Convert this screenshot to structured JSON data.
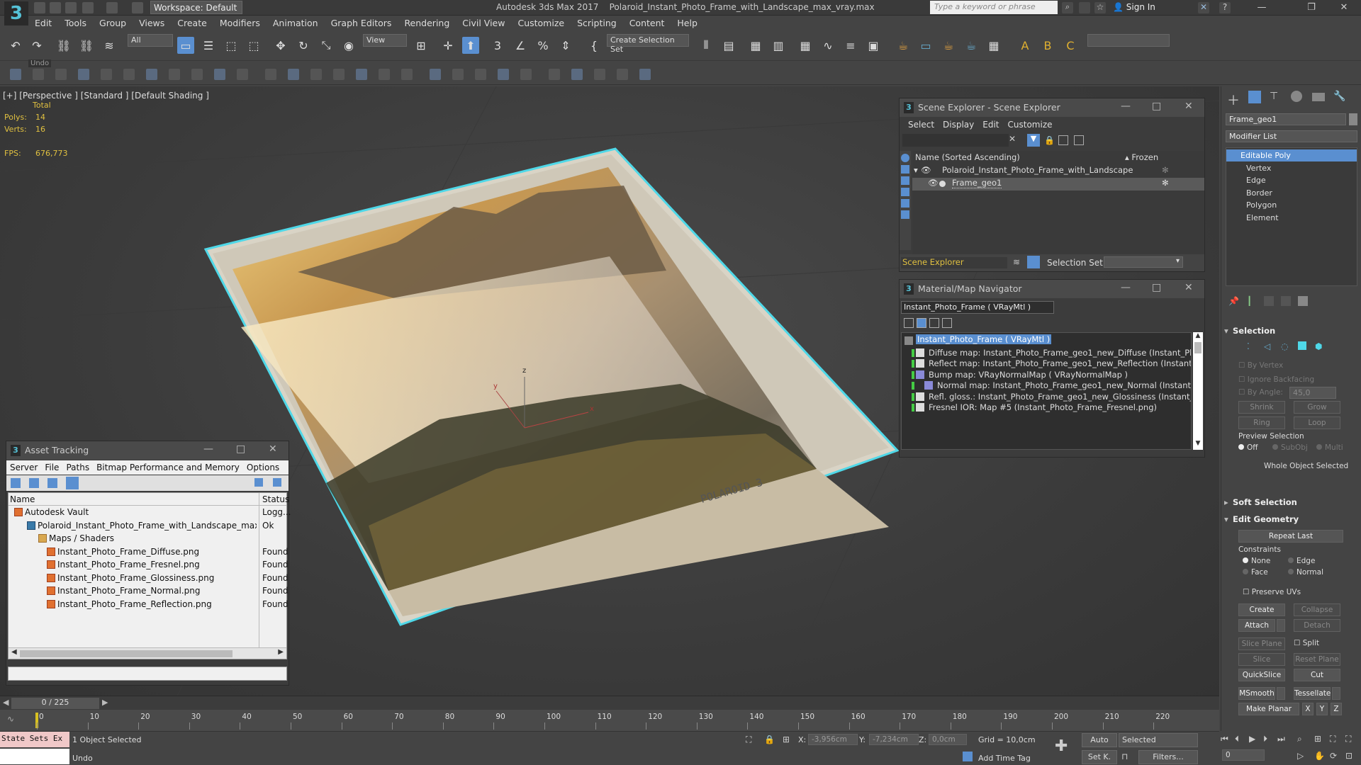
{
  "window": {
    "app_title": "Autodesk 3ds Max 2017",
    "file_title": "Polaroid_Instant_Photo_Frame_with_Landscape_max_vray.max",
    "workspace": "Workspace: Default",
    "search_placeholder": "Type a keyword or phrase",
    "sign_in": "Sign In",
    "logo": "3"
  },
  "menu": [
    "Edit",
    "Tools",
    "Group",
    "Views",
    "Create",
    "Modifiers",
    "Animation",
    "Graph Editors",
    "Rendering",
    "Civil View",
    "Customize",
    "Scripting",
    "Content",
    "Help"
  ],
  "toolbar": {
    "filter": "All",
    "refcoord": "View",
    "selection_set": "Create Selection Set",
    "undo_tooltip": "Undo"
  },
  "viewport": {
    "label": "[+] [Perspective ] [Standard ] [Default Shading ]",
    "stats_header": "Total",
    "polys_label": "Polys:",
    "polys": "14",
    "verts_label": "Verts:",
    "verts": "16",
    "fps_label": "FPS:",
    "fps": "676,773",
    "photo_text": "POLAROID 3",
    "gizmo_z": "z",
    "gizmo_x": "x",
    "gizmo_y": "y"
  },
  "scene_explorer": {
    "title": "Scene Explorer - Scene Explorer",
    "menu": [
      "Select",
      "Display",
      "Edit",
      "Customize"
    ],
    "col_name": "Name (Sorted Ascending)",
    "col_frozen": "▴ Frozen",
    "items": [
      {
        "label": "Polaroid_Instant_Photo_Frame_with_Landscape"
      },
      {
        "label": "Frame_geo1"
      }
    ],
    "footer_name": "Scene Explorer",
    "selection_set_label": "Selection Set:"
  },
  "material_navigator": {
    "title": "Material/Map Navigator",
    "current": "Instant_Photo_Frame  ( VRayMtl )",
    "root": "Instant_Photo_Frame  ( VRayMtl )",
    "maps": [
      "Diffuse map: Instant_Photo_Frame_geo1_new_Diffuse (Instant_Photo_Frame_D",
      "Reflect map: Instant_Photo_Frame_geo1_new_Reflection (Instant_Photo_Fram",
      "Bump map: VRayNormalMap  ( VRayNormalMap )",
      "Normal map: Instant_Photo_Frame_geo1_new_Normal (Instant_Photo_Frame",
      "Refl. gloss.: Instant_Photo_Frame_geo1_new_Glossiness (Instant_Photo_Frame",
      "Fresnel IOR: Map #5 (Instant_Photo_Frame_Fresnel.png)"
    ]
  },
  "asset_tracking": {
    "title": "Asset Tracking",
    "menu": [
      "Server",
      "File",
      "Paths",
      "Bitmap Performance and Memory",
      "Options"
    ],
    "col_name": "Name",
    "col_status": "Status",
    "rows": [
      {
        "name": "Autodesk Vault",
        "status": "Logg...",
        "level": 0,
        "icon": "vault"
      },
      {
        "name": "Polaroid_Instant_Photo_Frame_with_Landscape_max_vray....",
        "status": "Ok",
        "level": 1,
        "icon": "max"
      },
      {
        "name": "Maps / Shaders",
        "status": "",
        "level": 2,
        "icon": "folder"
      },
      {
        "name": "Instant_Photo_Frame_Diffuse.png",
        "status": "Found",
        "level": 3,
        "icon": "file"
      },
      {
        "name": "Instant_Photo_Frame_Fresnel.png",
        "status": "Found",
        "level": 3,
        "icon": "file"
      },
      {
        "name": "Instant_Photo_Frame_Glossiness.png",
        "status": "Found",
        "level": 3,
        "icon": "file"
      },
      {
        "name": "Instant_Photo_Frame_Normal.png",
        "status": "Found",
        "level": 3,
        "icon": "file"
      },
      {
        "name": "Instant_Photo_Frame_Reflection.png",
        "status": "Found",
        "level": 3,
        "icon": "file"
      }
    ]
  },
  "command_panel": {
    "object_name": "Frame_geo1",
    "modifier_list": "Modifier List",
    "stack": [
      "Editable Poly",
      "Vertex",
      "Edge",
      "Border",
      "Polygon",
      "Element"
    ],
    "selection": {
      "title": "Selection",
      "by_vertex": "By Vertex",
      "ignore_backfacing": "Ignore Backfacing",
      "by_angle": "By Angle:",
      "angle_value": "45,0",
      "shrink": "Shrink",
      "grow": "Grow",
      "ring": "Ring",
      "loop": "Loop",
      "preview_label": "Preview Selection",
      "off": "Off",
      "subobj": "SubObj",
      "multi": "Multi",
      "status": "Whole Object Selected"
    },
    "soft_selection": "Soft Selection",
    "edit_geometry": {
      "title": "Edit Geometry",
      "repeat_last": "Repeat Last",
      "constraints": "Constraints",
      "none": "None",
      "edge": "Edge",
      "face": "Face",
      "normal": "Normal",
      "preserve_uvs": "Preserve UVs",
      "create": "Create",
      "collapse": "Collapse",
      "attach": "Attach",
      "detach": "Detach",
      "slice_plane": "Slice Plane",
      "split": "Split",
      "slice": "Slice",
      "reset_plane": "Reset Plane",
      "quickslice": "QuickSlice",
      "cut": "Cut",
      "msmooth": "MSmooth",
      "tessellate": "Tessellate",
      "make_planar": "Make Planar",
      "x": "X",
      "y": "Y",
      "z": "Z"
    }
  },
  "timeline": {
    "frame": "0 / 225",
    "ticks": [
      "0",
      "10",
      "20",
      "30",
      "40",
      "50",
      "60",
      "70",
      "80",
      "90",
      "100",
      "110",
      "120",
      "130",
      "140",
      "150",
      "160",
      "170",
      "180",
      "190",
      "200",
      "210",
      "220"
    ]
  },
  "status": {
    "maxscript": "State Sets Ex",
    "selected": "1 Object Selected",
    "prompt": "Undo",
    "x_label": "X:",
    "x": "-3,956cm",
    "y_label": "Y:",
    "y": "-7,234cm",
    "z_label": "Z:",
    "z": "0,0cm",
    "grid": "Grid = 10,0cm",
    "add_time_tag": "Add Time Tag",
    "auto": "Auto",
    "set_key": "Set K.",
    "selected_dropdown": "Selected",
    "filters": "Filters...",
    "frame_field": "0"
  },
  "colors": {
    "accent_blue": "#5a8fd0",
    "selection_cyan": "#4fd8e8",
    "stats_yellow": "#e0c040"
  }
}
